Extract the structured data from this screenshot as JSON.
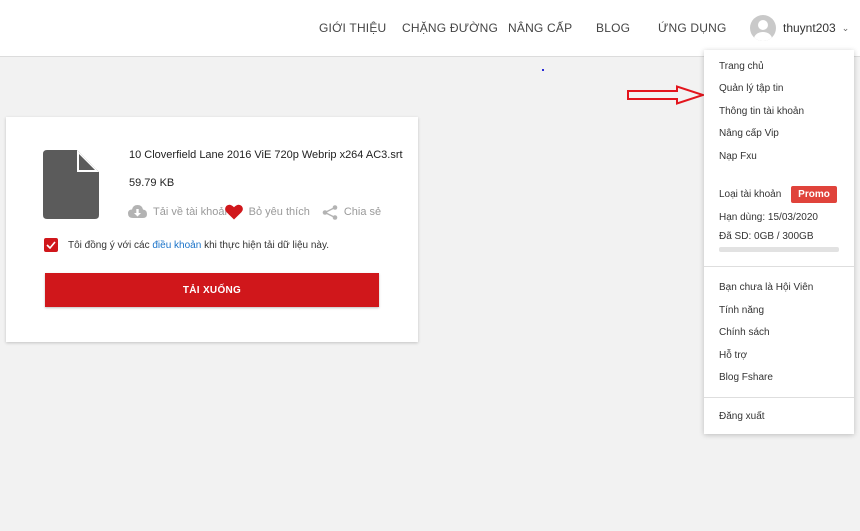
{
  "nav": {
    "items": [
      "GIỚI THIỆU",
      "CHẶNG ĐƯỜNG",
      "NÂNG CẤP",
      "BLOG",
      "ỨNG DỤNG"
    ],
    "username": "thuynt203"
  },
  "file": {
    "name": "10 Cloverfield Lane 2016 ViE 720p Webrip x264 AC3.srt",
    "size": "59.79 KB",
    "actions": {
      "download_to_account": "Tải về tài khoản",
      "unfavorite": "Bỏ yêu thích",
      "share": "Chia sẻ"
    },
    "agree": {
      "before": "Tôi đồng ý với các ",
      "link": "điều khoản",
      "after": " khi thực hiện tải dữ liệu này.",
      "checked": true
    },
    "download_button": "TẢI XUỐNG"
  },
  "menu": {
    "group1": [
      "Trang chủ",
      "Quản lý tập tin",
      "Thông tin tài khoản",
      "Nâng cấp Vip",
      "Nạp Fxu"
    ],
    "account_type_label": "Loại tài khoản",
    "account_type_badge": "Promo",
    "expiry": "Hạn dùng: 15/03/2020",
    "used": "Đã SD: 0GB / 300GB",
    "used_fraction": 0,
    "group2": [
      "Bạn chưa là Hội Viên",
      "Tính năng",
      "Chính sách",
      "Hỗ trợ",
      "Blog Fshare"
    ],
    "logout": "Đăng xuất"
  },
  "colors": {
    "accent_red": "#d0171b",
    "promo_red": "#e0433b",
    "link_blue": "#1a73c9"
  }
}
